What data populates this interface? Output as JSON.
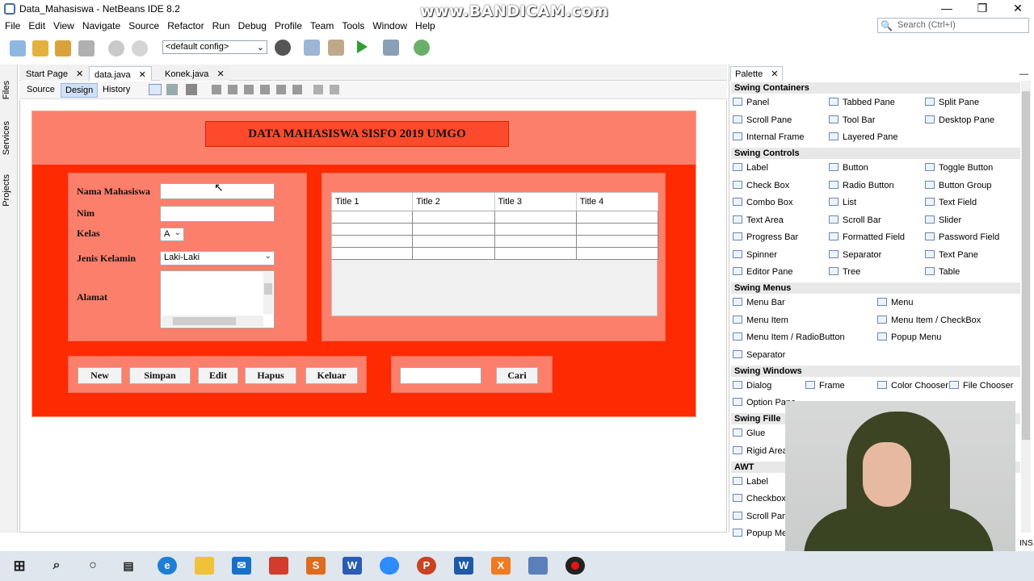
{
  "window": {
    "title": "Data_Mahasiswa - NetBeans IDE 8.2",
    "watermark": "www.BANDICAM.com"
  },
  "menu": [
    "File",
    "Edit",
    "View",
    "Navigate",
    "Source",
    "Refactor",
    "Run",
    "Debug",
    "Profile",
    "Team",
    "Tools",
    "Window",
    "Help"
  ],
  "search": {
    "placeholder": "Search (Ctrl+I)"
  },
  "toolbar": {
    "config": "<default config>"
  },
  "left_panels": [
    "Files",
    "Services",
    "Projects"
  ],
  "editor_tabs": [
    {
      "label": "Start Page",
      "active": false
    },
    {
      "label": "data.java",
      "active": true
    },
    {
      "label": "Konek.java",
      "active": false
    }
  ],
  "view_tabs": [
    "Source",
    "Design",
    "History"
  ],
  "form": {
    "title": "DATA MAHASISWA SISFO 2019 UMGO",
    "labels": {
      "nama": "Nama Mahasiswa",
      "nim": "Nim",
      "kelas": "Kelas",
      "jenis_kelamin": "Jenis Kelamin",
      "alamat": "Alamat"
    },
    "kelas_value": "A",
    "jenis_kelamin_value": "Laki-Laki",
    "table_columns": [
      "Title 1",
      "Title 2",
      "Title 3",
      "Title 4"
    ],
    "buttons": [
      "New",
      "Simpan",
      "Edit",
      "Hapus",
      "Keluar"
    ],
    "search_button": "Cari"
  },
  "palette": {
    "tab": "Palette",
    "sections": [
      {
        "name": "Swing Containers",
        "items": [
          "Panel",
          "Tabbed Pane",
          "Split Pane",
          "Scroll Pane",
          "Tool Bar",
          "Desktop Pane",
          "Internal Frame",
          "Layered Pane"
        ]
      },
      {
        "name": "Swing Controls",
        "items": [
          "Label",
          "Button",
          "Toggle Button",
          "Check Box",
          "Radio Button",
          "Button Group",
          "Combo Box",
          "List",
          "Text Field",
          "Text Area",
          "Scroll Bar",
          "Slider",
          "Progress Bar",
          "Formatted Field",
          "Password Field",
          "Spinner",
          "Separator",
          "Text Pane",
          "Editor Pane",
          "Tree",
          "Table"
        ]
      },
      {
        "name": "Swing Menus",
        "items": [
          "Menu Bar",
          "Menu",
          "Menu Item",
          "Menu Item / CheckBox",
          "Menu Item / RadioButton",
          "Popup Menu",
          "Separator"
        ]
      },
      {
        "name": "Swing Windows",
        "items": [
          "Dialog",
          "Frame",
          "Color Chooser",
          "File Chooser",
          "Option Pane"
        ]
      },
      {
        "name": "Swing Fille",
        "items": [
          "Glue",
          "Rigid Area"
        ]
      },
      {
        "name": "AWT",
        "items": [
          "Label",
          "Checkbox",
          "Scroll Pane",
          "Popup Men"
        ]
      }
    ]
  },
  "status": {
    "ins": "INS"
  }
}
